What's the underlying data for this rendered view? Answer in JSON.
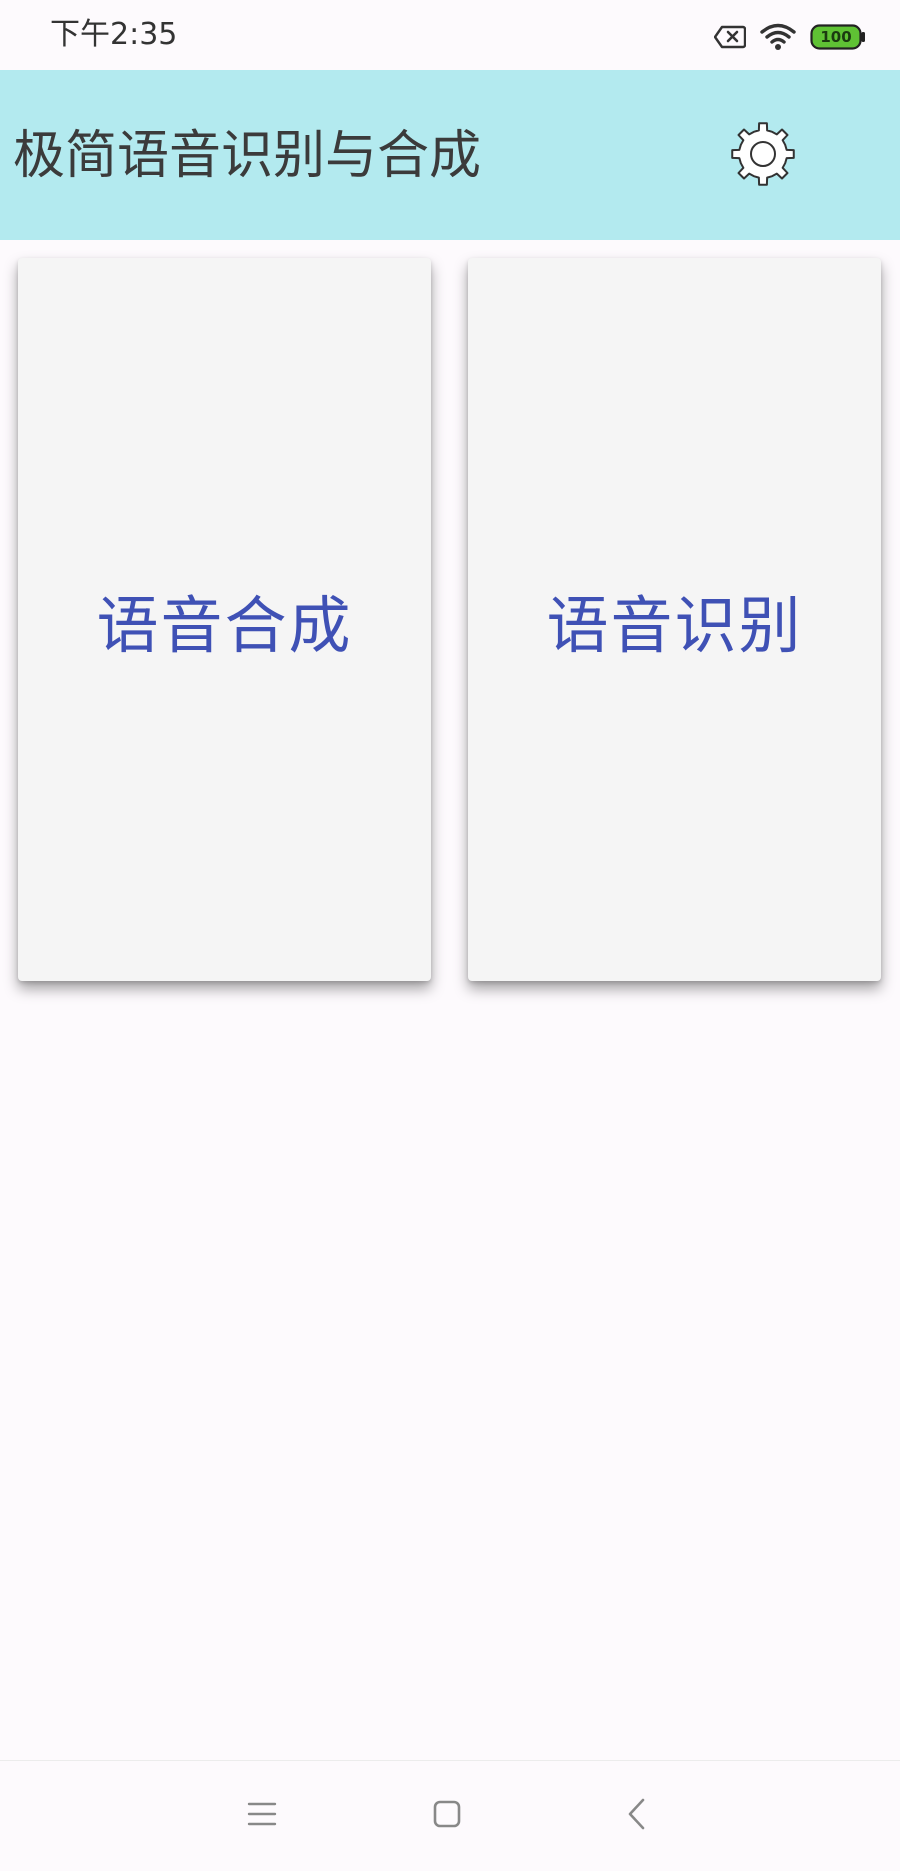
{
  "status_bar": {
    "time": "下午2:35",
    "battery_level": "100",
    "icons": [
      "sim-disabled-icon",
      "wifi-icon",
      "battery-icon"
    ]
  },
  "app_bar": {
    "title": "极简语音识别与合成",
    "settings_icon": "gear-icon",
    "background_color": "#b3eaef"
  },
  "cards": [
    {
      "label": "语音合成"
    },
    {
      "label": "语音识别"
    }
  ],
  "nav_bar": {
    "buttons": [
      "menu-icon",
      "home-icon",
      "back-icon"
    ]
  },
  "colors": {
    "card_text": "#3f51b5",
    "card_background": "#f5f5f5",
    "battery_fill": "#5fc234"
  }
}
